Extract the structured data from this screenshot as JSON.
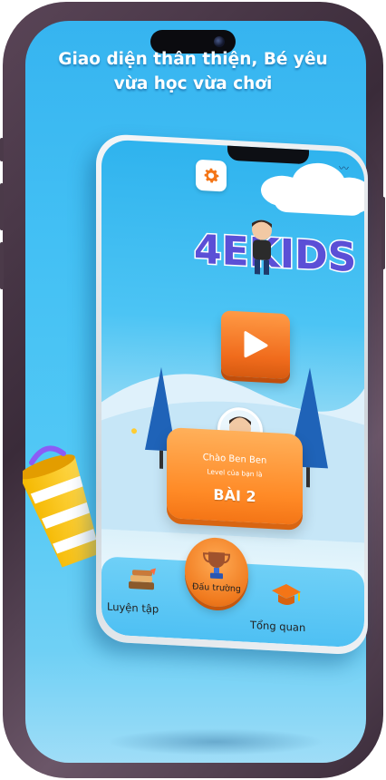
{
  "headline": {
    "line1": "Giao diện thân thiện, Bé yêu",
    "line2": "vừa học vừa chơi"
  },
  "app": {
    "logo_text": "4EKIDS",
    "settings_icon": "gear-icon",
    "play_icon": "play-icon",
    "greeting": "Chào Ben Ben",
    "level_caption": "Level của bạn là",
    "level_value": "BÀI 2",
    "nav": {
      "practice_label": "Luyện tập",
      "arena_label": "Đấu trường",
      "overview_label": "Tổng quan"
    }
  },
  "colors": {
    "background_blue": "#43c0f4",
    "accent_orange": "#f47516",
    "frame_purple": "#4b3a49"
  }
}
